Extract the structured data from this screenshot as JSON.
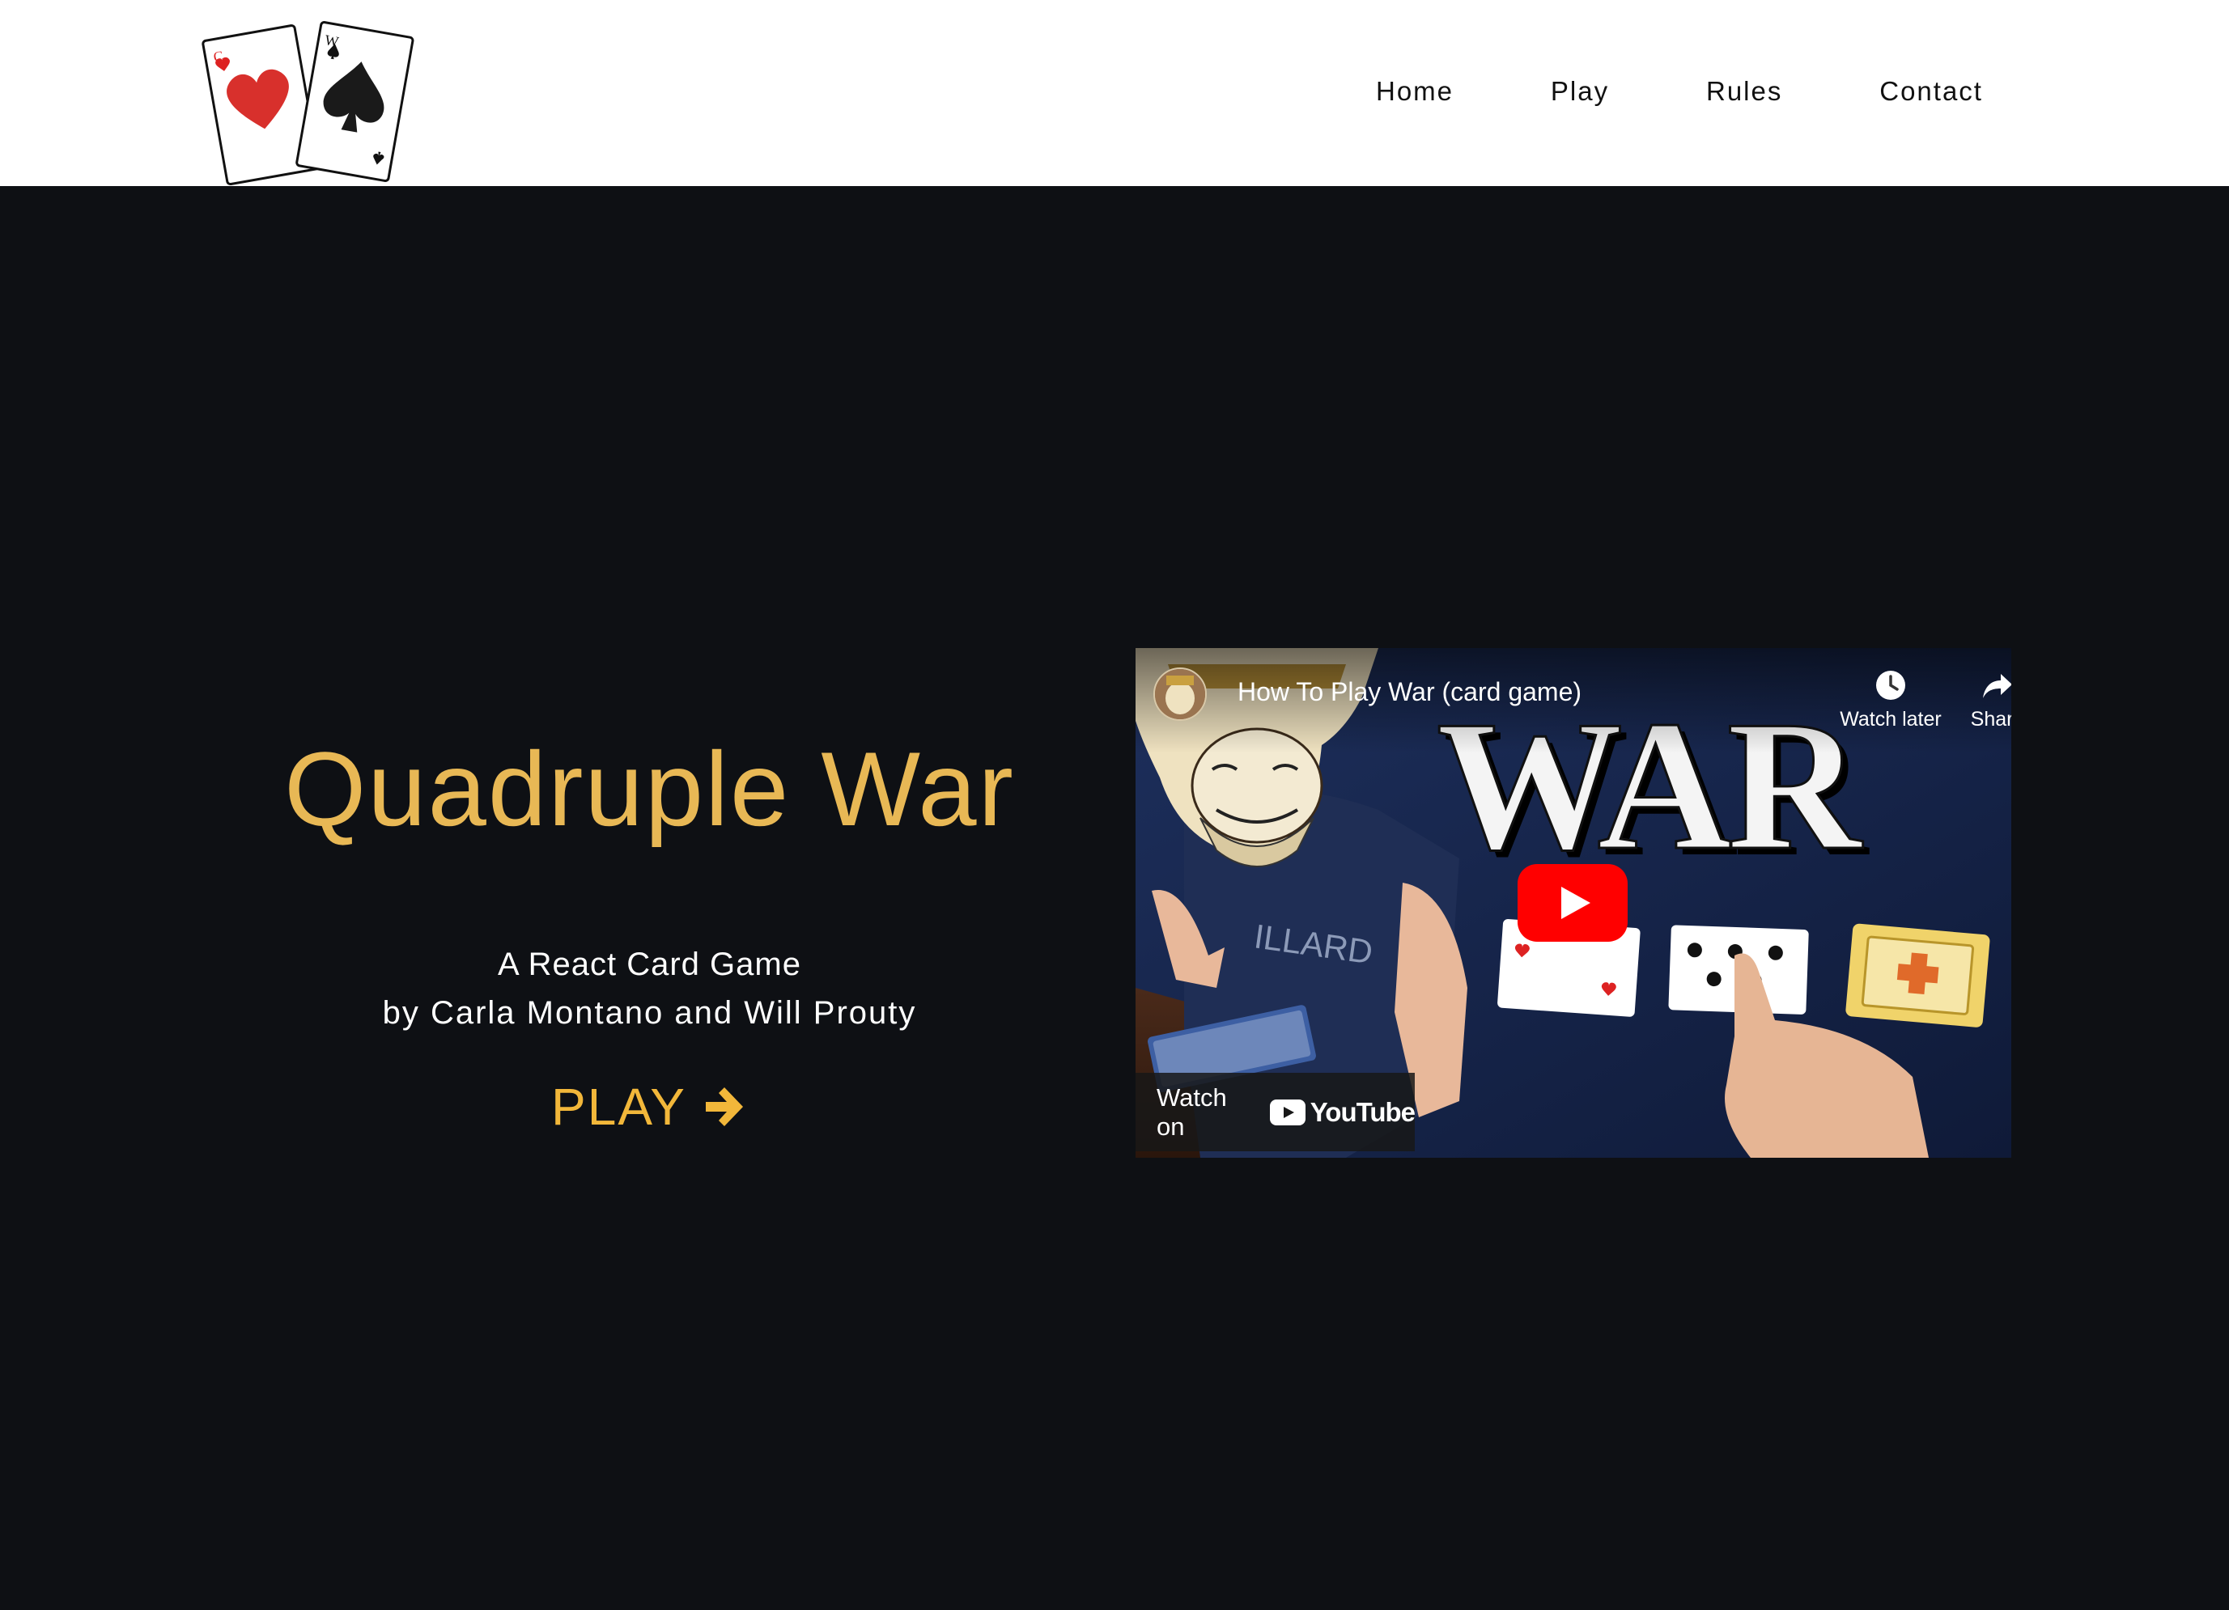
{
  "nav": {
    "items": [
      {
        "label": "Home"
      },
      {
        "label": "Play"
      },
      {
        "label": "Rules"
      },
      {
        "label": "Contact"
      }
    ]
  },
  "hero": {
    "title": "Quadruple War",
    "subtitle": "A React Card Game",
    "authors": "by Carla Montano and Will Prouty",
    "play_label": "PLAY",
    "play_icon": "arrow-right-icon"
  },
  "video": {
    "title": "How To Play War (card game)",
    "watch_later_label": "Watch later",
    "share_label": "Share",
    "watch_on_label": "Watch on",
    "youtube_label": "YouTube",
    "thumbnail_text": "WAR"
  },
  "colors": {
    "header_bg": "#ffffff",
    "page_bg": "#0e1014",
    "title_gold": "#e8b855",
    "play_gold": "#f2b73a",
    "youtube_red": "#ff0000"
  }
}
